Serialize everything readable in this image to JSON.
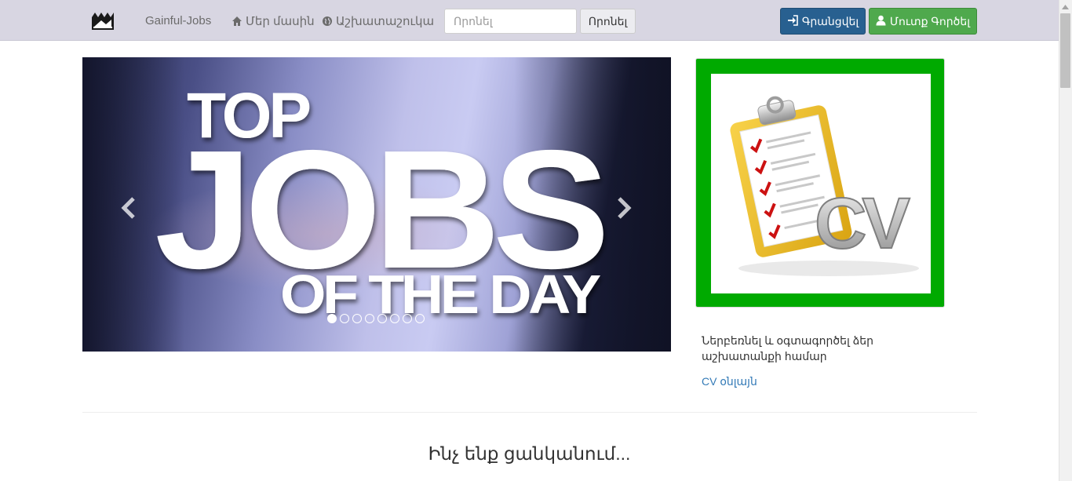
{
  "navbar": {
    "logo_icon": "crown-logo-icon",
    "brand": "Gainful-Jobs",
    "about": {
      "icon": "home-icon",
      "label": "Մեր մասին"
    },
    "employers": {
      "icon": "globe-icon",
      "label": "Աշխատաշուկա"
    },
    "search": {
      "placeholder": "Որոնել",
      "button_label": "Որոնել"
    },
    "login": {
      "icon": "sign-in-icon",
      "label": "Գրանցվել"
    },
    "register": {
      "icon": "user-icon",
      "label": "Մուտք Գործել"
    },
    "colors": {
      "bar": "#d8d6e2",
      "login": "#286090",
      "register": "#4fa94d"
    }
  },
  "carousel": {
    "slide_text": {
      "top": "TOP",
      "main": "JOBS",
      "bottom": "OF THE DAY"
    },
    "indicator_count": 8,
    "active_index": 0,
    "prev_icon": "chevron-left-icon",
    "next_icon": "chevron-right-icon"
  },
  "cv_panel": {
    "image_icon": "clipboard-cv-icon",
    "image_text": "CV",
    "border_color": "#00aa00",
    "description": "Ներբեռնել և օգտագործել ձեր աշխատանքի համար",
    "link_label": "CV օնլայն"
  },
  "section": {
    "title": "Ինչ ենք ցանկանում..."
  }
}
